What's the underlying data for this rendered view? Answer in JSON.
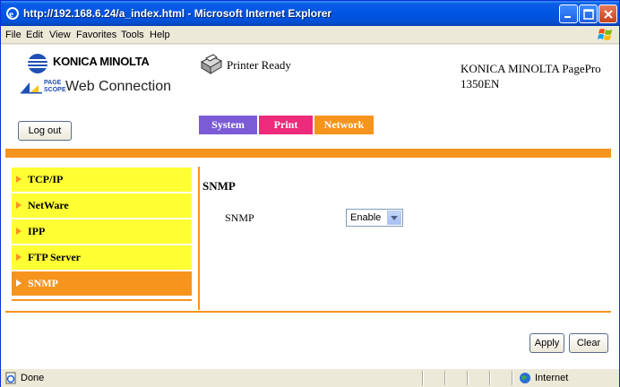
{
  "window": {
    "title": "http://192.168.6.24/a_index.html - Microsoft Internet Explorer"
  },
  "menu": {
    "items": [
      "File",
      "Edit",
      "View",
      "Favorites",
      "Tools",
      "Help"
    ]
  },
  "header": {
    "brand": "KONICA MINOLTA",
    "pagescope_small_line1": "PAGE",
    "pagescope_small_line2": "SCOPE",
    "web_connection": "Web Connection",
    "printer_status": "Printer Ready",
    "model_line1": "KONICA MINOLTA PagePro",
    "model_line2": "1350EN",
    "logout_label": "Log out"
  },
  "tabs": [
    {
      "label": "System",
      "color": "#7b5cd6"
    },
    {
      "label": "Print",
      "color": "#ee2a7b"
    },
    {
      "label": "Network",
      "color": "#f7941d"
    }
  ],
  "sidebar": {
    "items": [
      {
        "label": "TCP/IP",
        "active": false
      },
      {
        "label": "NetWare",
        "active": false
      },
      {
        "label": "IPP",
        "active": false
      },
      {
        "label": "FTP Server",
        "active": false
      },
      {
        "label": "SNMP",
        "active": true
      }
    ]
  },
  "main": {
    "section_title": "SNMP",
    "field_label": "SNMP",
    "select_value": "Enable"
  },
  "footer": {
    "apply_label": "Apply",
    "clear_label": "Clear"
  },
  "statusbar": {
    "status": "Done",
    "zone": "Internet"
  },
  "colors": {
    "accent_orange": "#f7941d",
    "sidebar_yellow": "#ffff33",
    "brand_blue": "#1e4fb4"
  }
}
